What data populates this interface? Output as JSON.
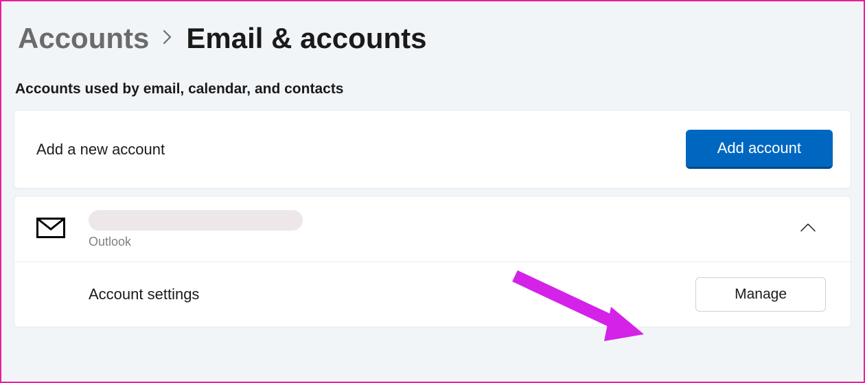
{
  "breadcrumb": {
    "parent": "Accounts",
    "current": "Email & accounts"
  },
  "section": {
    "heading": "Accounts used by email, calendar, and contacts"
  },
  "add_account": {
    "label": "Add a new account",
    "button": "Add account"
  },
  "account": {
    "type": "Outlook",
    "settings_label": "Account settings",
    "manage_button": "Manage"
  }
}
